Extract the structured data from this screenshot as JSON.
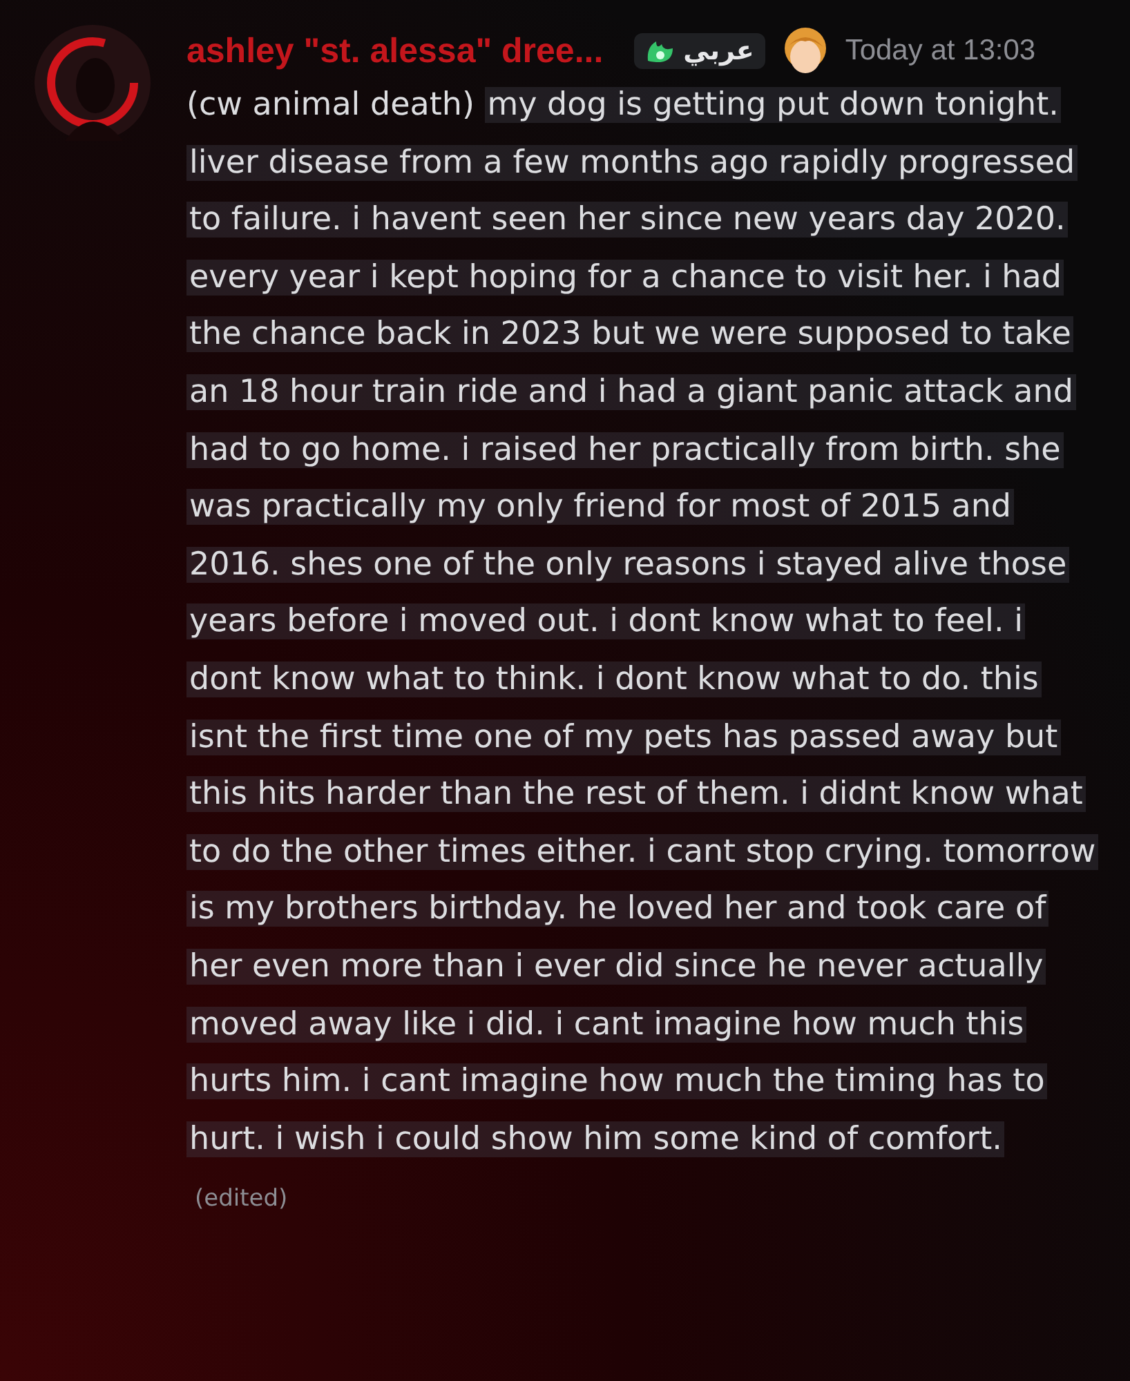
{
  "message": {
    "author": "ashley \"st. alessa\" dree...",
    "tag": "عربي",
    "timestamp": "Today at 13:03",
    "prefix": "(cw animal death)",
    "spoiler": "my dog is getting put down tonight. liver disease from a few months ago rapidly progressed to failure. i havent seen her since new years day 2020. every year i kept hoping for a chance to visit her. i had the chance back in 2023 but we were supposed to take an 18 hour train ride and i had a giant panic attack and had to go home. i raised her practically from birth. she was practically my only friend for most of 2015 and 2016. shes one of the only reasons i stayed alive those years before i moved out. i dont know what to feel. i dont know what to think. i dont know what to do. this isnt the first time one of my pets has passed away but this hits harder than the rest of them. i didnt know what to do the other times either. i cant stop crying. tomorrow is my brothers birthday. he loved her and took care of her even more than i ever did since he never actually moved away like i did. i cant imagine how much this hurts him. i cant imagine how much the timing has to hurt. i wish i could show him some kind of comfort.",
    "spoiler_revealed": true,
    "edited": "(edited)"
  }
}
